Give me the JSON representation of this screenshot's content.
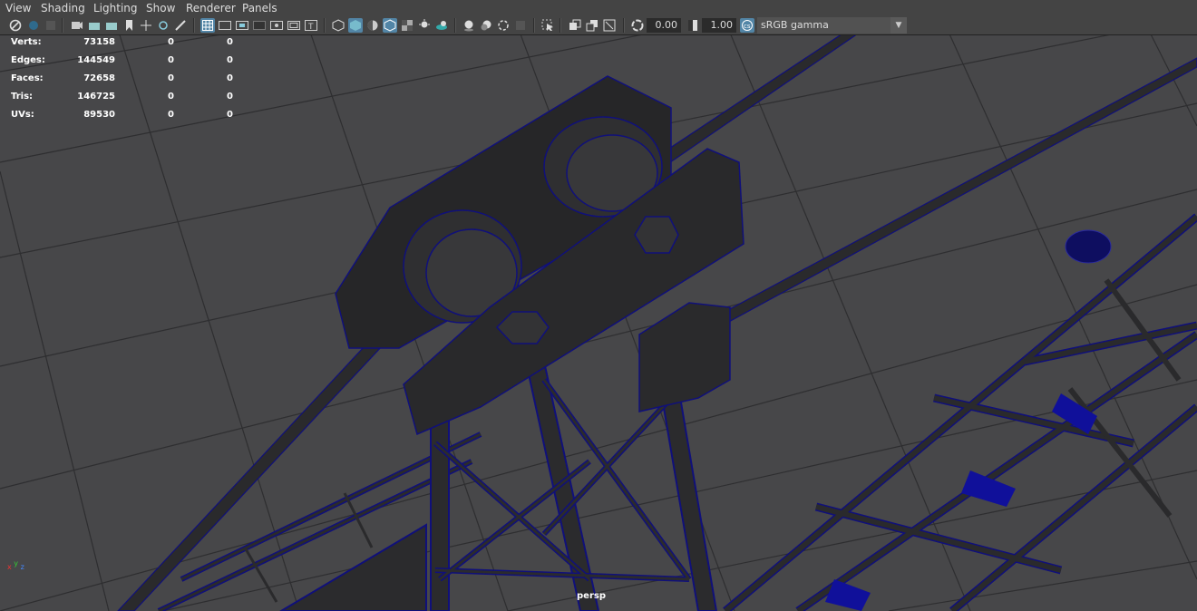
{
  "menu": [
    "View",
    "Shading",
    "Lighting",
    "Show",
    "Renderer",
    "Panels"
  ],
  "toolbar": {
    "icons": [
      "camera-select-icon",
      "lock-camera-icon",
      "film-gate-icon",
      "image-plane-icon",
      "camera-attr-icon",
      "bookmark-icon",
      "grease-pencil-icon",
      "grid-icon",
      "film-gate-toggle-icon",
      "resolution-gate-icon",
      "gate-mask-icon",
      "field-chart-icon",
      "safe-action-icon",
      "safe-title-icon",
      "wireframe-icon",
      "smooth-shade-icon",
      "wireframe-on-shaded-icon",
      "textured-icon",
      "use-all-lights-icon",
      "shadows-icon",
      "screen-space-ao-icon",
      "motion-blur-icon",
      "multisample-aa-icon",
      "depth-of-field-icon",
      "isolate-select-icon",
      "xray-icon",
      "xray-joints-icon",
      "xray-components-icon",
      "exposure-icon",
      "gamma-icon",
      "view-transform-icon"
    ],
    "exposure_value": "0.00",
    "gamma_value": "1.00",
    "color_space": "sRGB gamma"
  },
  "hud": {
    "rows": [
      {
        "label": "Verts:",
        "total": "73158",
        "selected": "0",
        "other": "0"
      },
      {
        "label": "Edges:",
        "total": "144549",
        "selected": "0",
        "other": "0"
      },
      {
        "label": "Faces:",
        "total": "72658",
        "selected": "0",
        "other": "0"
      },
      {
        "label": "Tris:",
        "total": "146725",
        "selected": "0",
        "other": "0"
      },
      {
        "label": "UVs:",
        "total": "89530",
        "selected": "0",
        "other": "0"
      }
    ]
  },
  "viewport": {
    "camera": "persp",
    "axis": {
      "x": "x",
      "y": "y",
      "z": "z"
    }
  },
  "colors": {
    "ui_bg": "#444444",
    "viewport_bg": "#474749",
    "wire": "#1a1aa0",
    "mesh": "#2a2a2c",
    "accent": "#5285a6"
  }
}
